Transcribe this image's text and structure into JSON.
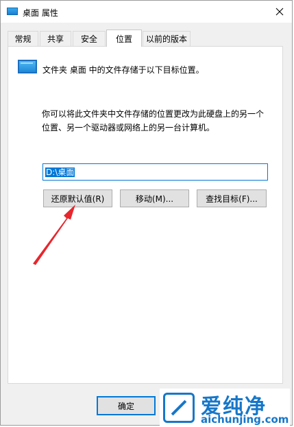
{
  "window": {
    "title": "桌面 属性"
  },
  "tabs": [
    {
      "label": "常规"
    },
    {
      "label": "共享"
    },
    {
      "label": "安全"
    },
    {
      "label": "位置",
      "active": true
    },
    {
      "label": "以前的版本"
    }
  ],
  "location": {
    "info": "文件夹 桌面 中的文件存储于以下目标位置。",
    "description_line1": "你可以将此文件夹中文件存储的位置更改为此硬盘上的另一个",
    "description_line2": "位置、另一个驱动器或网络上的另一台计算机。",
    "path_value": "D:\\桌面",
    "buttons": {
      "restore_default": "还原默认值(R)",
      "move": "移动(M)...",
      "find_target": "查找目标(F)..."
    }
  },
  "footer": {
    "ok_label": "确定"
  },
  "watermark": {
    "brand": "爱纯净",
    "url": "aichunjing.com"
  },
  "colors": {
    "accent": "#0078d7",
    "arrow": "#e8262d",
    "watermark": "#1677c9"
  }
}
